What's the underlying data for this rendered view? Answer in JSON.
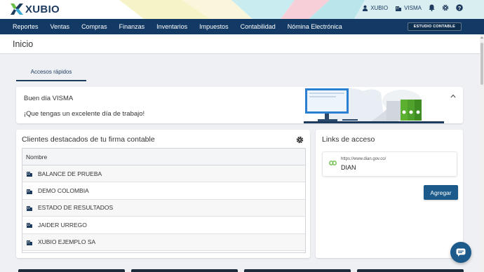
{
  "brand": {
    "name": "XUBIO",
    "primary": "#123a64",
    "accent": "#1b5a8a"
  },
  "topbar": {
    "user_label": "XUBIO",
    "company_label": "VISMA",
    "icons": [
      "user-icon",
      "building-icon",
      "bell-icon",
      "gear-icon",
      "help-icon"
    ]
  },
  "nav": {
    "items": [
      "Reportes",
      "Ventas",
      "Compras",
      "Finanzas",
      "Inventarios",
      "Impuestos",
      "Contabilidad",
      "Nómina Electrónica"
    ],
    "studio_button": "ESTUDIO CONTABLE"
  },
  "page": {
    "title": "Inicio"
  },
  "tabs": [
    {
      "label": "Accesos rápidos",
      "active": true
    }
  ],
  "welcome": {
    "greeting": "Buen día VISMA",
    "message": "¡Que tengas un excelente día de trabajo!"
  },
  "clients": {
    "title": "Clientes destacados de tu firma contable",
    "column_header": "Nombre",
    "rows": [
      "BALANCE DE PRUEBA",
      "DEMO COLOMBIA",
      "ESTADO DE RESULTADOS",
      "JAIDER URREGO",
      "XUBIO EJEMPLO SA"
    ]
  },
  "links": {
    "title": "Links de acceso",
    "items": [
      {
        "url": "https://www.dian.gov.co/",
        "name": "DIAN"
      }
    ],
    "add_button": "Agregar"
  }
}
